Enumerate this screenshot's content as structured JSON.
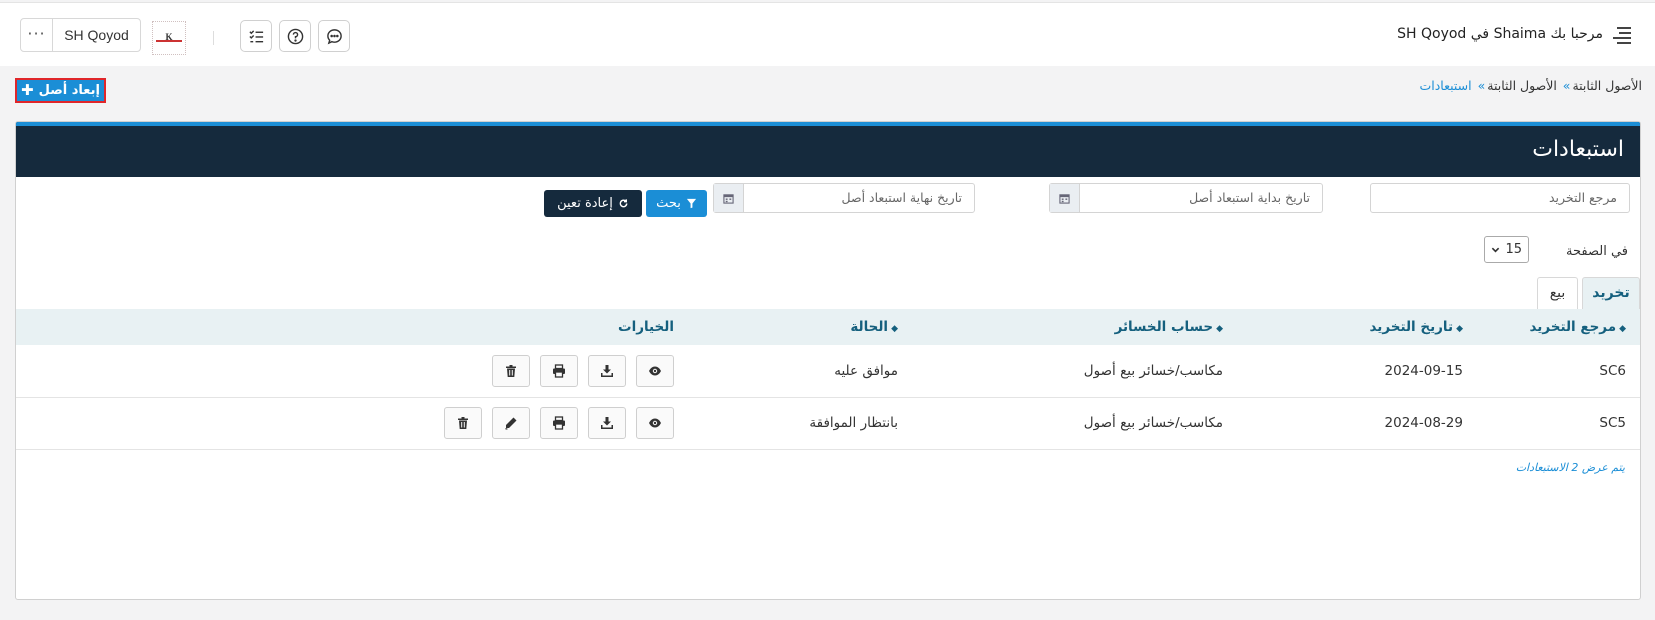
{
  "header": {
    "welcome": "مرحبا بك Shaima في SH Qoyod",
    "company": "SH Qoyod",
    "more": "···",
    "logo_text": "K"
  },
  "breadcrumb": {
    "items": [
      "الأصول الثابتة",
      "الأصول الثابتة",
      "استبعادات"
    ],
    "separator": "»"
  },
  "add_button": {
    "label": "إبعاد أصل"
  },
  "panel": {
    "title": "استبعادات"
  },
  "filters": {
    "reference_placeholder": "مرجع التخريد",
    "start_date_placeholder": "تاريخ بداية استبعاد أصل",
    "end_date_placeholder": "تاريخ نهاية استبعاد أصل",
    "search_label": "بحث",
    "reset_label": "إعادة تعين"
  },
  "pagination": {
    "per_page_label": "في الصفحة",
    "per_page_value": "15"
  },
  "tabs": [
    {
      "label": "تخريد",
      "active": true
    },
    {
      "label": "بيع",
      "active": false
    }
  ],
  "table": {
    "headers": [
      "مرجع التخريد",
      "تاريخ التخريد",
      "حساب الخسائر",
      "الحالة",
      "الخيارات"
    ],
    "rows": [
      {
        "ref": "SC6",
        "date": "2024-09-15",
        "account": "مكاسب/خسائر بيع أصول",
        "status": "موافق عليه"
      },
      {
        "ref": "SC5",
        "date": "2024-08-29",
        "account": "مكاسب/خسائر بيع أصول",
        "status": "بانتظار الموافقة"
      }
    ]
  },
  "footer_note": "يتم عرض 2 الاستبعادات",
  "colors": {
    "primary": "#1b8ed6",
    "header_dark": "#152a3d",
    "table_header": "#e8f1f3",
    "highlight": "#e0262a"
  }
}
